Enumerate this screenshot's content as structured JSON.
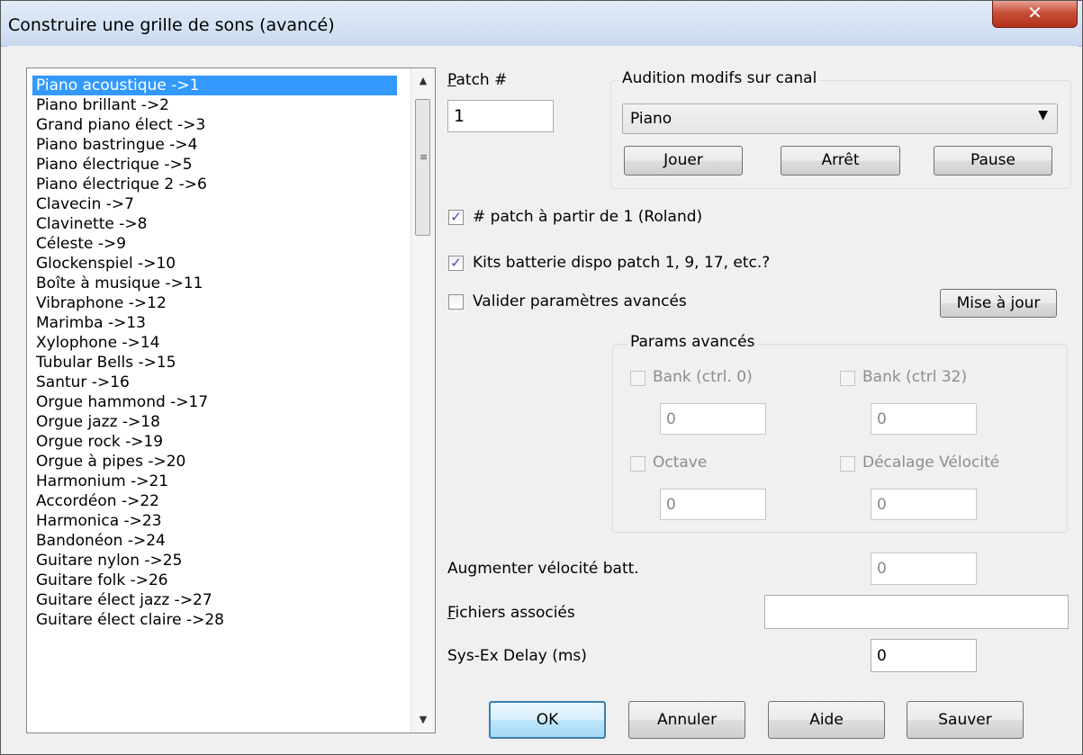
{
  "window": {
    "title": "Construire une grille de sons (avancé)",
    "close_glyph": "✕"
  },
  "patch_list": {
    "items": [
      "Piano acoustique  ->1",
      "Piano brillant  ->2",
      "Grand piano élect  ->3",
      "Piano bastringue  ->4",
      "Piano électrique  ->5",
      "Piano électrique 2  ->6",
      "Clavecin  ->7",
      "Clavinette  ->8",
      "Céleste  ->9",
      "Glockenspiel  ->10",
      "Boîte à musique  ->11",
      "Vibraphone  ->12",
      "Marimba  ->13",
      "Xylophone  ->14",
      "Tubular Bells  ->15",
      "Santur  ->16",
      "Orgue hammond  ->17",
      "Orgue jazz  ->18",
      "Orgue rock  ->19",
      "Orgue à pipes  ->20",
      "Harmonium  ->21",
      "Accordéon  ->22",
      "Harmonica  ->23",
      "Bandonéon  ->24",
      "Guitare nylon  ->25",
      "Guitare folk  ->26",
      "Guitare élect jazz  ->27",
      "Guitare élect claire  ->28"
    ],
    "selected_index": 0,
    "scroll_up": "▲",
    "scroll_down": "▼",
    "grip": "≡"
  },
  "patch": {
    "label_u": "P",
    "label_rest": "atch #",
    "value": "1"
  },
  "audition": {
    "group_label": "Audition modifs sur canal",
    "selected": "Piano",
    "arrow": "▼",
    "play": "Jouer",
    "stop": "Arrêt",
    "pause": "Pause"
  },
  "options": {
    "patch_from_1": {
      "label": "# patch à partir de 1 (Roland)",
      "checked": true
    },
    "drum_kits": {
      "label": "Kits batterie dispo patch 1, 9, 17, etc.?",
      "checked": true
    },
    "advanced": {
      "label": "Valider paramètres avancés",
      "checked": false
    },
    "check_glyph": "✓",
    "update_button": "Mise à jour"
  },
  "advanced_params": {
    "group_label": "Params avancés",
    "bank0": {
      "label": "Bank (ctrl. 0)",
      "value": "0"
    },
    "bank32": {
      "label": "Bank (ctrl 32)",
      "value": "0"
    },
    "octave": {
      "label": "Octave",
      "value": "0"
    },
    "velocity_offset": {
      "label": "Décalage Vélocité",
      "value": "0"
    }
  },
  "fields": {
    "drum_velocity": {
      "label": "Augmenter vélocité batt.",
      "value": "0"
    },
    "associated_files": {
      "label_u": "F",
      "label_rest": "ichiers associés",
      "value": ""
    },
    "sysex_delay": {
      "label": "Sys-Ex Delay (ms)",
      "value": "0"
    }
  },
  "buttons": {
    "ok": "OK",
    "cancel": "Annuler",
    "help": "Aide",
    "save": "Sauver"
  }
}
